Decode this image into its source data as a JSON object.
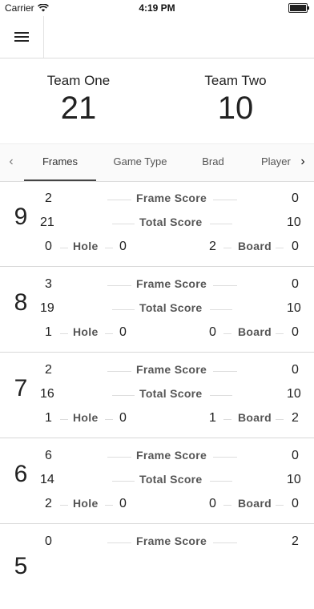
{
  "status": {
    "carrier": "Carrier",
    "time": "4:19 PM"
  },
  "teams": [
    {
      "name": "Team One",
      "score": "21"
    },
    {
      "name": "Team Two",
      "score": "10"
    }
  ],
  "tabs": [
    "Frames",
    "Game Type",
    "Brad",
    "Player"
  ],
  "labels": {
    "frame_score": "Frame Score",
    "total_score": "Total Score",
    "hole": "Hole",
    "board": "Board"
  },
  "frames": [
    {
      "number": "9",
      "t1_frame": "2",
      "t2_frame": "0",
      "t1_total": "21",
      "t2_total": "10",
      "t1_hole_left": "0",
      "t1_hole_right": "0",
      "t2_board_left": "2",
      "t2_board_right": "0"
    },
    {
      "number": "8",
      "t1_frame": "3",
      "t2_frame": "0",
      "t1_total": "19",
      "t2_total": "10",
      "t1_hole_left": "1",
      "t1_hole_right": "0",
      "t2_board_left": "0",
      "t2_board_right": "0"
    },
    {
      "number": "7",
      "t1_frame": "2",
      "t2_frame": "0",
      "t1_total": "16",
      "t2_total": "10",
      "t1_hole_left": "1",
      "t1_hole_right": "0",
      "t2_board_left": "1",
      "t2_board_right": "2"
    },
    {
      "number": "6",
      "t1_frame": "6",
      "t2_frame": "0",
      "t1_total": "14",
      "t2_total": "10",
      "t1_hole_left": "2",
      "t1_hole_right": "0",
      "t2_board_left": "0",
      "t2_board_right": "0"
    },
    {
      "number": "5",
      "t1_frame": "0",
      "t2_frame": "2"
    }
  ]
}
